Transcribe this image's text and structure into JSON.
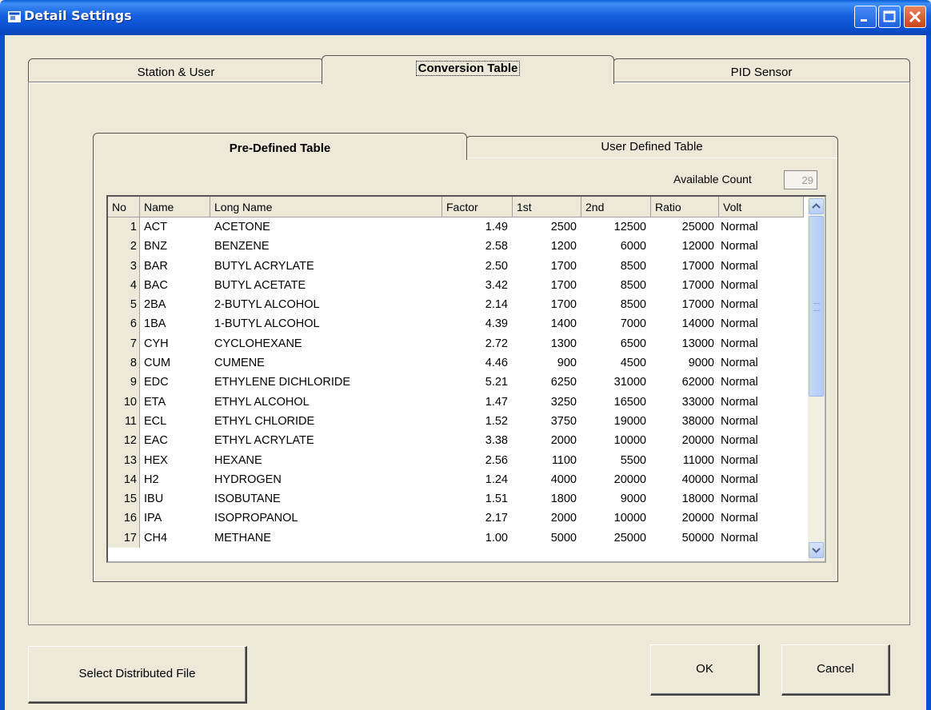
{
  "window": {
    "title": "Detail Settings",
    "minimize": "minimize",
    "maximize": "maximize",
    "close": "close"
  },
  "tabs": [
    {
      "label": "Station & User",
      "active": false
    },
    {
      "label": "Conversion Table",
      "active": true
    },
    {
      "label": "PID Sensor",
      "active": false
    }
  ],
  "subtabs": [
    {
      "label": "Pre-Defined Table",
      "active": true
    },
    {
      "label": "User Defined Table",
      "active": false
    }
  ],
  "available_count": {
    "label": "Available Count",
    "value": "29"
  },
  "table": {
    "columns": [
      "No",
      "Name",
      "Long Name",
      "Factor",
      "1st",
      "2nd",
      "Ratio",
      "Volt"
    ],
    "rows": [
      [
        "1",
        "ACT",
        "ACETONE",
        "1.49",
        "2500",
        "12500",
        "25000",
        "Normal"
      ],
      [
        "2",
        "BNZ",
        "BENZENE",
        "2.58",
        "1200",
        "6000",
        "12000",
        "Normal"
      ],
      [
        "3",
        "BAR",
        "BUTYL ACRYLATE",
        "2.50",
        "1700",
        "8500",
        "17000",
        "Normal"
      ],
      [
        "4",
        "BAC",
        "BUTYL ACETATE",
        "3.42",
        "1700",
        "8500",
        "17000",
        "Normal"
      ],
      [
        "5",
        "2BA",
        "2-BUTYL ALCOHOL",
        "2.14",
        "1700",
        "8500",
        "17000",
        "Normal"
      ],
      [
        "6",
        "1BA",
        "1-BUTYL ALCOHOL",
        "4.39",
        "1400",
        "7000",
        "14000",
        "Normal"
      ],
      [
        "7",
        "CYH",
        "CYCLOHEXANE",
        "2.72",
        "1300",
        "6500",
        "13000",
        "Normal"
      ],
      [
        "8",
        "CUM",
        "CUMENE",
        "4.46",
        "900",
        "4500",
        "9000",
        "Normal"
      ],
      [
        "9",
        "EDC",
        "ETHYLENE DICHLORIDE",
        "5.21",
        "6250",
        "31000",
        "62000",
        "Normal"
      ],
      [
        "10",
        "ETA",
        "ETHYL ALCOHOL",
        "1.47",
        "3250",
        "16500",
        "33000",
        "Normal"
      ],
      [
        "11",
        "ECL",
        "ETHYL CHLORIDE",
        "1.52",
        "3750",
        "19000",
        "38000",
        "Normal"
      ],
      [
        "12",
        "EAC",
        "ETHYL ACRYLATE",
        "3.38",
        "2000",
        "10000",
        "20000",
        "Normal"
      ],
      [
        "13",
        "HEX",
        "HEXANE",
        "2.56",
        "1100",
        "5500",
        "11000",
        "Normal"
      ],
      [
        "14",
        "H2",
        "HYDROGEN",
        "1.24",
        "4000",
        "20000",
        "40000",
        "Normal"
      ],
      [
        "15",
        "IBU",
        "ISOBUTANE",
        "1.51",
        "1800",
        "9000",
        "18000",
        "Normal"
      ],
      [
        "16",
        "IPA",
        "ISOPROPANOL",
        "2.17",
        "2000",
        "10000",
        "20000",
        "Normal"
      ],
      [
        "17",
        "CH4",
        "METHANE",
        "1.00",
        "5000",
        "25000",
        "50000",
        "Normal"
      ]
    ]
  },
  "buttons": {
    "distributed": "Select Distributed File",
    "ok": "OK",
    "cancel": "Cancel"
  },
  "icons": {
    "scroll_up": "chevron-up-icon",
    "scroll_down": "chevron-down-icon",
    "window": "window-app-icon"
  }
}
